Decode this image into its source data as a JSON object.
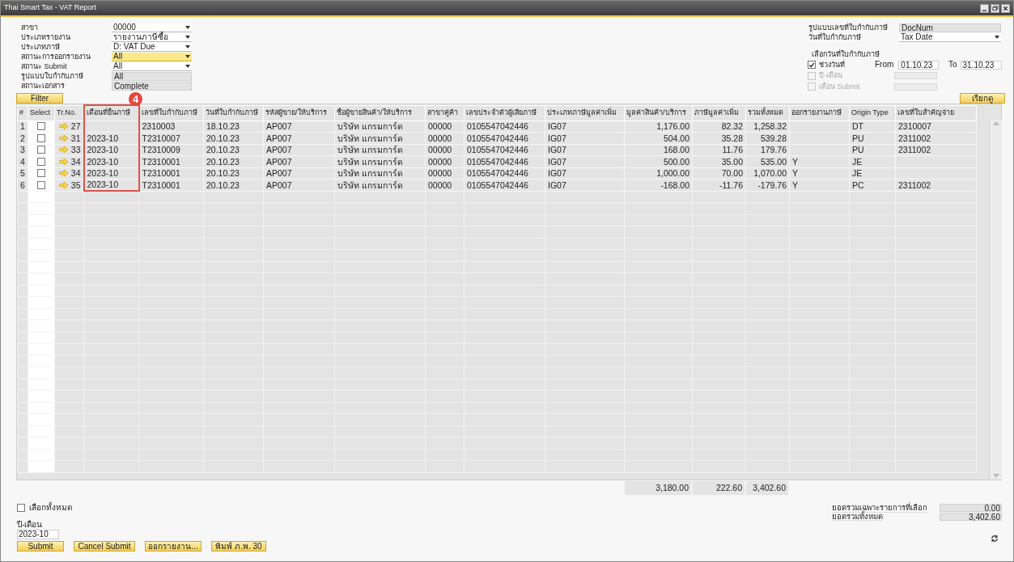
{
  "window": {
    "title": "Thai Smart Tax - VAT Report"
  },
  "filters": [
    {
      "label": "สาขา",
      "value": "00000",
      "kind": "dropdown",
      "highlighted": false
    },
    {
      "label": "ประเภทรายงาน",
      "value": "รายงานภาษีซื้อ",
      "kind": "dropdown",
      "highlighted": false
    },
    {
      "label": "ประเภทภาษี",
      "value": "D: VAT Due",
      "kind": "dropdown",
      "highlighted": false
    },
    {
      "label": "สถานะการออกรายงาน",
      "value": "All",
      "kind": "dropdown",
      "highlighted": true
    },
    {
      "label": "สถานะ Submit",
      "value": "All",
      "kind": "dropdown",
      "highlighted": false
    },
    {
      "label": "รูปแบบใบกำกับภาษี",
      "value": "All",
      "kind": "readonly",
      "highlighted": false
    },
    {
      "label": "สถานะเอกสาร",
      "value": "Complete",
      "kind": "readonly",
      "highlighted": false
    }
  ],
  "filter_button": "Filter",
  "right_options": [
    {
      "label": "รูปแบบเลขที่ใบกำกับภาษี",
      "value": "DocNum",
      "kind": "readonly"
    },
    {
      "label": "วันที่ใบกำกับภาษี",
      "value": "Tax Date",
      "kind": "dropdown"
    }
  ],
  "date_selection": {
    "title": "เลือกวันที่ใบกำกับภาษี",
    "options": [
      {
        "kind": "range",
        "label": "ช่วงวันที่",
        "checked": true,
        "disabled": false,
        "from_label": "From",
        "from": "01.10.23",
        "to_label": "To",
        "to": "31.10.23"
      },
      {
        "kind": "single",
        "label": "ปี-เดือน",
        "checked": false,
        "disabled": true
      },
      {
        "kind": "single",
        "label": "เดือน Submit",
        "checked": false,
        "disabled": true
      }
    ]
  },
  "fetch_button": "เรียกดู",
  "table": {
    "columns": [
      "#",
      "Select",
      "Tr.No.",
      "เดือนที่ยื่นภาษี",
      "เลขที่ใบกำกับภาษี",
      "วันที่ใบกำกับภาษี",
      "รหัสผู้ขาย/ให้บริการ",
      "ชื่อผู้ขายสินค้า/ให้บริการ",
      "สาขาคู่ค้า",
      "เลขประจำตัวผู้เสียภาษี",
      "ประเภทภาษีมูลค่าเพิ่ม",
      "มูลค่าสินค้า/บริการ",
      "ภาษีมูลค่าเพิ่ม",
      "รวมทั้งหมด",
      "ออกรายงานภาษี",
      "Origin Type",
      "เลขที่ใบสำคัญจ่าย"
    ],
    "rows": [
      {
        "checked": false,
        "cells": [
          "1",
          "",
          "27",
          "",
          "2310003",
          "18.10.23",
          "AP007",
          "บริษัท แกรมการ์ด",
          "00000",
          "0105547042446",
          "IG07",
          "1,176.00",
          "82.32",
          "1,258.32",
          "",
          "DT",
          "2310007"
        ]
      },
      {
        "checked": false,
        "cells": [
          "2",
          "",
          "31",
          "2023-10",
          "T2310007",
          "20.10.23",
          "AP007",
          "บริษัท แกรมการ์ด",
          "00000",
          "0105547042446",
          "IG07",
          "504.00",
          "35.28",
          "539.28",
          "",
          "PU",
          "2311002"
        ]
      },
      {
        "checked": false,
        "cells": [
          "3",
          "",
          "33",
          "2023-10",
          "T2310009",
          "20.10.23",
          "AP007",
          "บริษัท แกรมการ์ด",
          "00000",
          "0105547042446",
          "IG07",
          "168.00",
          "11.76",
          "179.76",
          "",
          "PU",
          "2311002"
        ]
      },
      {
        "checked": false,
        "cells": [
          "4",
          "",
          "34",
          "2023-10",
          "T2310001",
          "20.10.23",
          "AP007",
          "บริษัท แกรมการ์ด",
          "00000",
          "0105547042446",
          "IG07",
          "500.00",
          "35.00",
          "535.00",
          "Y",
          "JE",
          ""
        ]
      },
      {
        "checked": false,
        "cells": [
          "5",
          "",
          "34",
          "2023-10",
          "T2310001",
          "20.10.23",
          "AP007",
          "บริษัท แกรมการ์ด",
          "00000",
          "0105547042446",
          "IG07",
          "1,000.00",
          "70.00",
          "1,070.00",
          "Y",
          "JE",
          ""
        ]
      },
      {
        "checked": false,
        "cells": [
          "6",
          "",
          "35",
          "2023-10",
          "T2310001",
          "20.10.23",
          "AP007",
          "บริษัท แกรมการ์ด",
          "00000",
          "0105547042446",
          "IG07",
          "-168.00",
          "-11.76",
          "-179.76",
          "Y",
          "PC",
          "2311002"
        ]
      }
    ],
    "totals": [
      "3,180.00",
      "222.60",
      "3,402.60"
    ]
  },
  "annotation": {
    "label": "4"
  },
  "select_all": {
    "label": "เลือกทั้งหมด",
    "checked": false
  },
  "period": {
    "label": "ปี-เดือน",
    "value": "2023-10"
  },
  "buttons": [
    "Submit",
    "Cancel Submit",
    "ออกรายงาน...",
    "พิมพ์ ภ.พ. 30"
  ],
  "summary": [
    {
      "label": "ยอดรวมเฉพาะรายการที่เลือก",
      "value": "0.00"
    },
    {
      "label": "ยอดรวมทั้งหมด",
      "value": "3,402.60"
    }
  ]
}
